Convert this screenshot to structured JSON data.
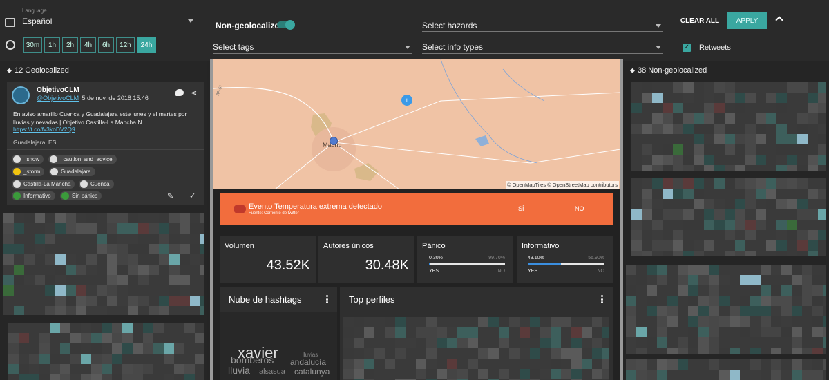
{
  "filters": {
    "language": {
      "label": "Language",
      "value": "Español"
    },
    "time_buttons": [
      "30m",
      "1h",
      "2h",
      "4h",
      "6h",
      "12h",
      "24h"
    ],
    "active_time": "24h",
    "non_geolocalized": {
      "label": "Non-geolocalized",
      "on": true
    },
    "select_tags": "Select tags",
    "select_hazards": "Select hazards",
    "select_info_types": "Select info types",
    "clear_all": "CLEAR ALL",
    "apply": "APPLY",
    "retweets": {
      "label": "Retweets",
      "checked": true
    }
  },
  "left_panel": {
    "title": "12 Geolocalized",
    "tweet": {
      "name": "ObjetivoCLM",
      "handle": "@ObjetivoCLM",
      "date": "· 5 de nov. de 2018 15:46",
      "text": "En aviso amarillo Cuenca y Guadalajara este lunes y el martes por lluvias y nevadas | Objetivo Castilla-La Mancha N…",
      "link": "https://t.co/fv3koDV2Q9",
      "location": "Guadalajara, ES",
      "tags": [
        "_snow",
        "_caution_and_advice",
        "_storm",
        "Guadalajara",
        "Castilla-La Mancha",
        "Cuenca",
        "Informativo",
        "Sin pánico"
      ]
    }
  },
  "right_panel": {
    "title": "38 Non-geolocalized"
  },
  "map": {
    "city": "Madrid",
    "road": "AP-51",
    "attribution": "© OpenMapTiles © OpenStreetMap contributors"
  },
  "alert": {
    "title": "Evento Temperatura extrema detectado",
    "subtitle": "Fuente: Corriente de twitter",
    "yes": "SÍ",
    "no": "NO",
    "color": "#f26d3d"
  },
  "kpis": {
    "volume": {
      "label": "Volumen",
      "value": "43.52K"
    },
    "authors": {
      "label": "Autores únicos",
      "value": "30.48K"
    },
    "panic": {
      "label": "Pánico",
      "left_pct": "0.30%",
      "right_pct": "99.70%",
      "fill": 0.003,
      "yes": "YES",
      "no": "NO"
    },
    "info": {
      "label": "Informativo",
      "left_pct": "43.10%",
      "right_pct": "56.90%",
      "fill": 0.431,
      "yes": "YES",
      "no": "NO"
    }
  },
  "hashtags_card": {
    "title": "Nube de hashtags",
    "words": [
      "xavier",
      "bomberos",
      "andalucía",
      "lluvias",
      "lluvia",
      "alsasua",
      "catalunya"
    ]
  },
  "profiles_card": {
    "title": "Top perfiles"
  },
  "colors": {
    "accent": "#3aa7a0",
    "alert": "#f26d3d",
    "map": "#f0c3a5"
  }
}
